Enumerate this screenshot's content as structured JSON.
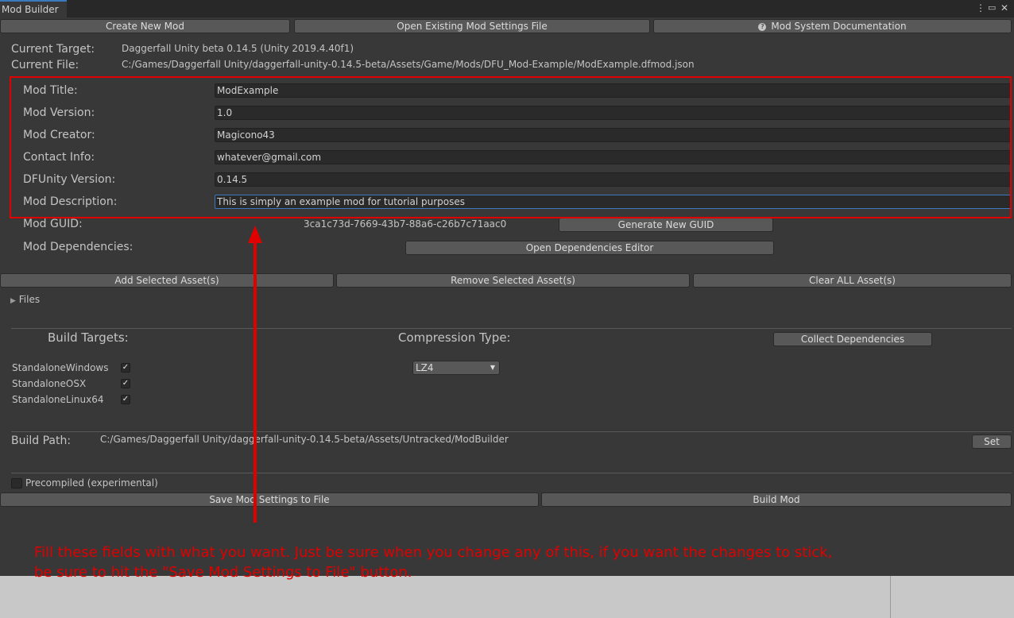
{
  "window": {
    "tab_title": "Mod Builder",
    "icons": [
      "kebab-menu-icon",
      "maximize-icon",
      "close-icon"
    ]
  },
  "toolbar": {
    "create_new": "Create New Mod",
    "open_existing": "Open Existing Mod Settings File",
    "documentation": "Mod System Documentation"
  },
  "target": {
    "current_target_label": "Current Target:",
    "current_target_value": "Daggerfall Unity beta 0.14.5 (Unity 2019.4.40f1)",
    "current_file_label": "Current File:",
    "current_file_value": "C:/Games/Daggerfall Unity/daggerfall-unity-0.14.5-beta/Assets/Game/Mods/DFU_Mod-Example/ModExample.dfmod.json"
  },
  "fields": {
    "title_label": "Mod Title:",
    "title_value": "ModExample",
    "version_label": "Mod Version:",
    "version_value": "1.0",
    "creator_label": "Mod Creator:",
    "creator_value": "Magicono43",
    "contact_label": "Contact Info:",
    "contact_value": "whatever@gmail.com",
    "dfunity_label": "DFUnity Version:",
    "dfunity_value": "0.14.5",
    "description_label": "Mod Description:",
    "description_value": "This is simply an example mod for tutorial purposes"
  },
  "guid": {
    "label": "Mod GUID:",
    "value": "3ca1c73d-7669-43b7-88a6-c26b7c71aac0",
    "generate_button": "Generate New GUID"
  },
  "dependencies": {
    "label": "Mod Dependencies:",
    "open_editor_button": "Open Dependencies Editor"
  },
  "assets": {
    "add_button": "Add Selected Asset(s)",
    "remove_button": "Remove Selected Asset(s)",
    "clear_button": "Clear ALL Asset(s)",
    "files_foldout": "Files"
  },
  "build": {
    "targets_label": "Build Targets:",
    "compression_label": "Compression Type:",
    "collect_button": "Collect Dependencies",
    "targets": [
      {
        "name": "StandaloneWindows",
        "checked": true
      },
      {
        "name": "StandaloneOSX",
        "checked": true
      },
      {
        "name": "StandaloneLinux64",
        "checked": true
      }
    ],
    "compression_value": "LZ4",
    "path_label": "Build Path:",
    "path_value": "C:/Games/Daggerfall Unity/daggerfall-unity-0.14.5-beta/Assets/Untracked/ModBuilder",
    "set_button": "Set",
    "precompiled_label": "Precompiled (experimental)",
    "precompiled_checked": false,
    "save_button": "Save Mod Settings to File",
    "build_button": "Build Mod"
  },
  "annotation": {
    "line1": "Fill these fields with what you want. Just be sure when you change any of this, if you want the changes to stick,",
    "line2": "be sure to hit the \"Save Mod Settings to File\" button.",
    "color": "#e00000"
  },
  "colors": {
    "background": "#383838",
    "button": "#585858",
    "field": "#2a2a2a",
    "focus_border": "#3a79bb",
    "annotation": "#e00000"
  }
}
